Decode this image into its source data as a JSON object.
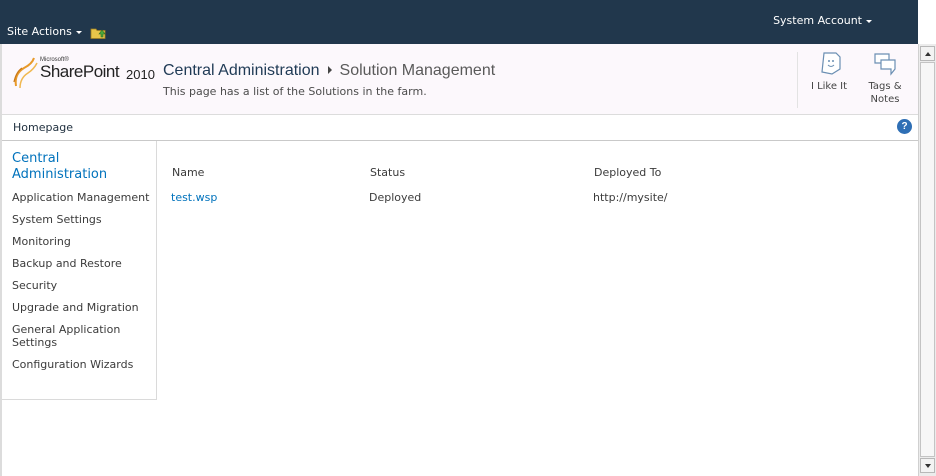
{
  "ribbon": {
    "site_actions": "Site Actions",
    "account": "System Account"
  },
  "logo": {
    "microsoft": "Microsoft®",
    "sharepoint": "SharePoint",
    "year": "2010"
  },
  "title": {
    "root": "Central Administration",
    "current": "Solution Management",
    "description": "This page has a list of the Solutions in the farm."
  },
  "social": {
    "like_label": "I Like It",
    "tags_label": "Tags & Notes"
  },
  "topnav": {
    "home": "Homepage",
    "help": "?"
  },
  "leftnav": {
    "heading": "Central Administration",
    "items": [
      {
        "label": "Application Management"
      },
      {
        "label": "System Settings"
      },
      {
        "label": "Monitoring"
      },
      {
        "label": "Backup and Restore"
      },
      {
        "label": "Security"
      },
      {
        "label": "Upgrade and Migration"
      },
      {
        "label": "General Application Settings"
      },
      {
        "label": "Configuration Wizards"
      }
    ]
  },
  "solutions": {
    "columns": [
      "Name",
      "Status",
      "Deployed To"
    ],
    "rows": [
      {
        "name": "test.wsp",
        "status": "Deployed",
        "deployed_to": "http://mysite/"
      }
    ]
  },
  "colors": {
    "ribbon": "#21374c",
    "link": "#0072bc",
    "title_bg": "#fcf8fc"
  }
}
